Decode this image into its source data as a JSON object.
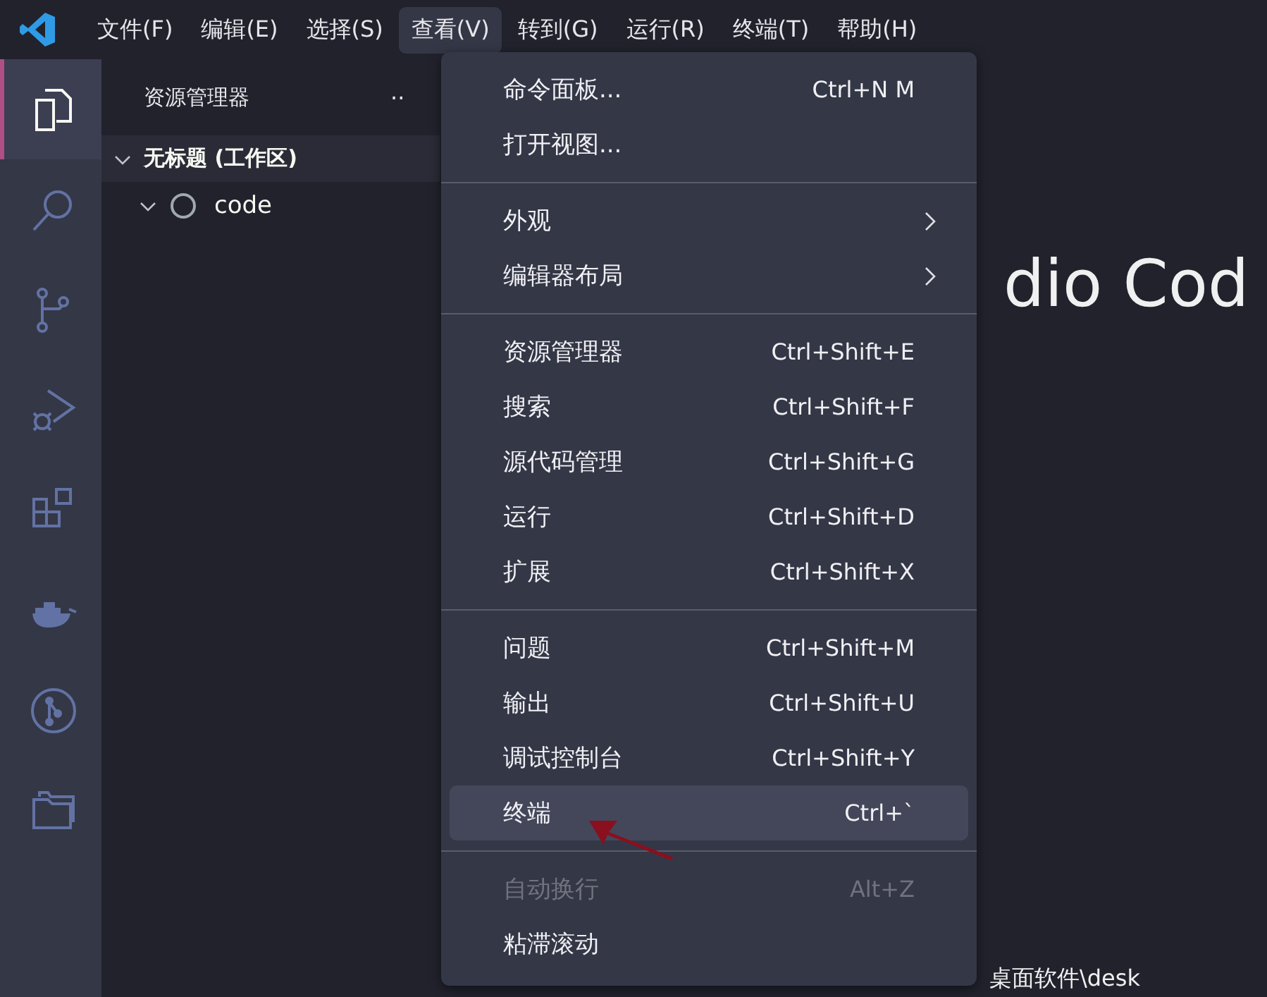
{
  "menubar": {
    "items": [
      {
        "label": "文件(F)",
        "selected": false
      },
      {
        "label": "编辑(E)",
        "selected": false
      },
      {
        "label": "选择(S)",
        "selected": false
      },
      {
        "label": "查看(V)",
        "selected": true
      },
      {
        "label": "转到(G)",
        "selected": false
      },
      {
        "label": "运行(R)",
        "selected": false
      },
      {
        "label": "终端(T)",
        "selected": false
      },
      {
        "label": "帮助(H)",
        "selected": false
      }
    ]
  },
  "activity_bar": {
    "items": [
      {
        "kind": "files",
        "selected": true
      },
      {
        "kind": "search",
        "selected": false
      },
      {
        "kind": "source-control",
        "selected": false
      },
      {
        "kind": "run-debug",
        "selected": false
      },
      {
        "kind": "extensions",
        "selected": false
      },
      {
        "kind": "docker",
        "selected": false
      },
      {
        "kind": "git-graph",
        "selected": false
      },
      {
        "kind": "folders",
        "selected": false
      }
    ]
  },
  "sidebar": {
    "title": "资源管理器",
    "more": "··",
    "tree": [
      {
        "label": "无标题 (工作区)",
        "expanded": true,
        "children": [
          {
            "label": "code",
            "expanded": true
          }
        ]
      }
    ]
  },
  "editor": {
    "heading": "dio Cod",
    "line": "桌面软件\\desk"
  },
  "view_menu": {
    "sections": [
      {
        "items": [
          {
            "label": "命令面板...",
            "shortcut": "Ctrl+N M",
            "submenu": false,
            "disabled": false,
            "selected": false
          },
          {
            "label": "打开视图...",
            "submenu": false,
            "disabled": false,
            "selected": false
          }
        ]
      },
      {
        "items": [
          {
            "label": "外观",
            "submenu": true,
            "disabled": false,
            "selected": false
          },
          {
            "label": "编辑器布局",
            "submenu": true,
            "disabled": false,
            "selected": false
          }
        ]
      },
      {
        "items": [
          {
            "label": "资源管理器",
            "shortcut": "Ctrl+Shift+E",
            "submenu": false,
            "disabled": false,
            "selected": false
          },
          {
            "label": "搜索",
            "shortcut": "Ctrl+Shift+F",
            "submenu": false,
            "disabled": false,
            "selected": false
          },
          {
            "label": "源代码管理",
            "shortcut": "Ctrl+Shift+G",
            "submenu": false,
            "disabled": false,
            "selected": false
          },
          {
            "label": "运行",
            "shortcut": "Ctrl+Shift+D",
            "submenu": false,
            "disabled": false,
            "selected": false
          },
          {
            "label": "扩展",
            "shortcut": "Ctrl+Shift+X",
            "submenu": false,
            "disabled": false,
            "selected": false
          }
        ]
      },
      {
        "items": [
          {
            "label": "问题",
            "shortcut": "Ctrl+Shift+M",
            "submenu": false,
            "disabled": false,
            "selected": false
          },
          {
            "label": "输出",
            "shortcut": "Ctrl+Shift+U",
            "submenu": false,
            "disabled": false,
            "selected": false
          },
          {
            "label": "调试控制台",
            "shortcut": "Ctrl+Shift+Y",
            "submenu": false,
            "disabled": false,
            "selected": false
          },
          {
            "label": "终端",
            "shortcut": "Ctrl+`",
            "submenu": false,
            "disabled": false,
            "selected": true
          }
        ]
      },
      {
        "items": [
          {
            "label": "自动换行",
            "shortcut": "Alt+Z",
            "submenu": false,
            "disabled": true,
            "selected": false
          },
          {
            "label": "粘滞滚动",
            "submenu": false,
            "disabled": false,
            "selected": false
          }
        ]
      }
    ]
  }
}
